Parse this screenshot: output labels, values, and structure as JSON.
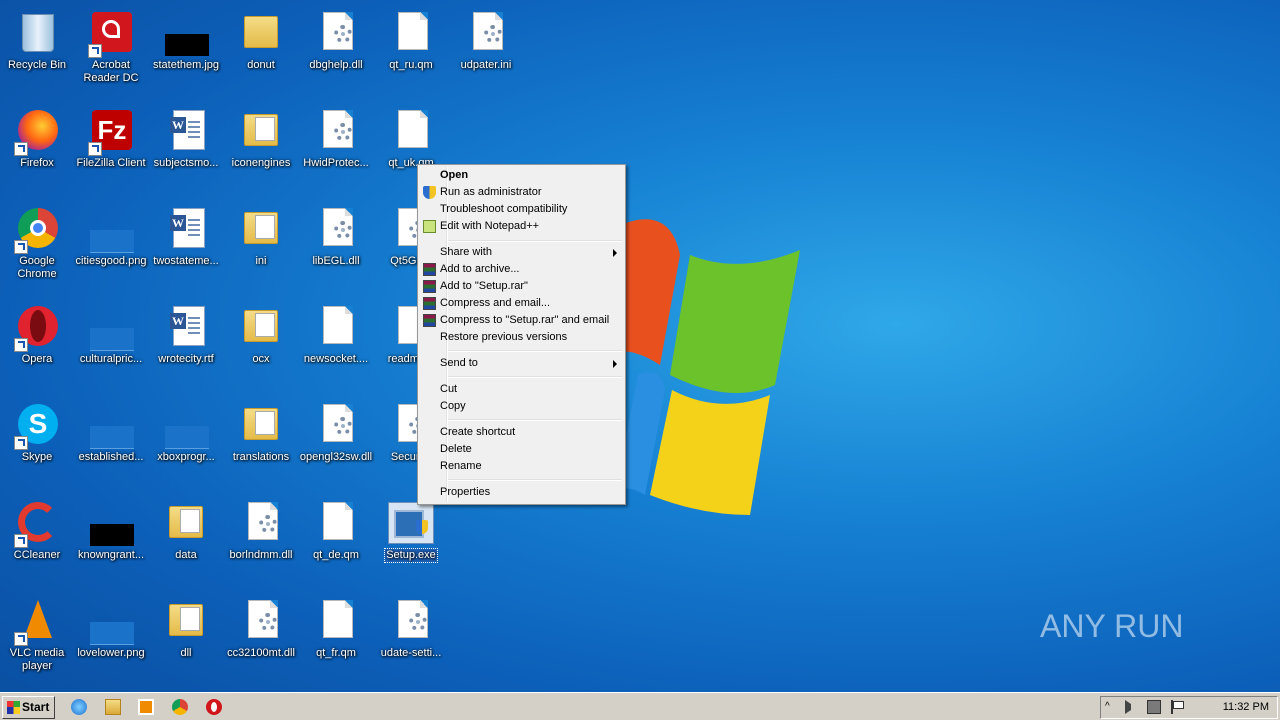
{
  "desktop": {
    "icons": [
      {
        "label": "Recycle Bin"
      },
      {
        "label": "Acrobat Reader DC"
      },
      {
        "label": "statethem.jpg"
      },
      {
        "label": "donut"
      },
      {
        "label": "dbghelp.dll"
      },
      {
        "label": "qt_ru.qm"
      },
      {
        "label": "udpater.ini"
      },
      {
        "label": "Firefox"
      },
      {
        "label": "FileZilla Client"
      },
      {
        "label": "subjectsmo..."
      },
      {
        "label": "iconengines"
      },
      {
        "label": "HwidProtec..."
      },
      {
        "label": "qt_uk.qm"
      },
      {
        "label": "Google Chrome"
      },
      {
        "label": "citiesgood.png"
      },
      {
        "label": "twostateme..."
      },
      {
        "label": "ini"
      },
      {
        "label": "libEGL.dll"
      },
      {
        "label": "Qt5Gu..."
      },
      {
        "label": "Opera"
      },
      {
        "label": "culturalpric..."
      },
      {
        "label": "wrotecity.rtf"
      },
      {
        "label": "ocx"
      },
      {
        "label": "newsocket...."
      },
      {
        "label": "readme..."
      },
      {
        "label": "Skype"
      },
      {
        "label": "established..."
      },
      {
        "label": "xboxprogr..."
      },
      {
        "label": "translations"
      },
      {
        "label": "opengl32sw.dll"
      },
      {
        "label": "Securi..."
      },
      {
        "label": "CCleaner"
      },
      {
        "label": "knowngrant..."
      },
      {
        "label": "data"
      },
      {
        "label": "borlndmm.dll"
      },
      {
        "label": "qt_de.qm"
      },
      {
        "label": "Setup.exe"
      },
      {
        "label": "VLC media player"
      },
      {
        "label": "lovelower.png"
      },
      {
        "label": "dll"
      },
      {
        "label": "cc32100mt.dll"
      },
      {
        "label": "qt_fr.qm"
      },
      {
        "label": "udate-setti..."
      }
    ]
  },
  "context_menu": {
    "open": "Open",
    "run_as_admin": "Run as administrator",
    "troubleshoot": "Troubleshoot compatibility",
    "edit_npp": "Edit with Notepad++",
    "share_with": "Share with",
    "add_archive": "Add to archive...",
    "add_setup_rar": "Add to \"Setup.rar\"",
    "compress_email": "Compress and email...",
    "compress_setup_email": "Compress to \"Setup.rar\" and email",
    "restore": "Restore previous versions",
    "send_to": "Send to",
    "cut": "Cut",
    "copy": "Copy",
    "create_shortcut": "Create shortcut",
    "delete": "Delete",
    "rename": "Rename",
    "properties": "Properties"
  },
  "taskbar": {
    "start_label": "Start",
    "clock": "11:32 PM"
  },
  "watermark": "ANY RUN"
}
